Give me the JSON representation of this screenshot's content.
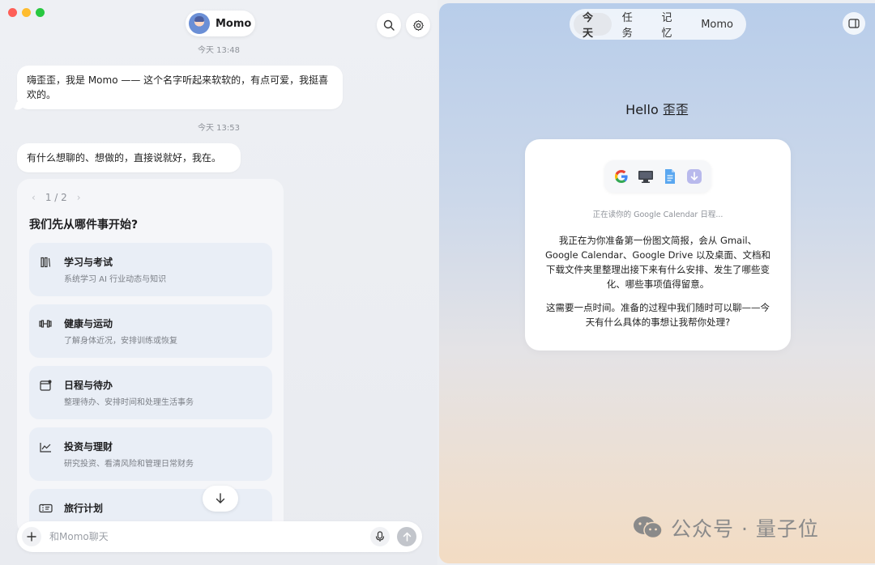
{
  "window": {
    "traffic_lights": [
      "close",
      "minimize",
      "zoom"
    ]
  },
  "header": {
    "agent_name": "Momo",
    "search_icon": "search-icon",
    "settings_icon": "gear-icon"
  },
  "chat": {
    "messages": [
      {
        "timestamp": "今天 13:48",
        "text": "嗨歪歪，我是 Momo —— 这个名字听起来软软的，有点可爱，我挺喜欢的。"
      },
      {
        "timestamp": "今天 13:53",
        "text": "有什么想聊的、想做的，直接说就好，我在。"
      }
    ],
    "card": {
      "pager": "1 / 2",
      "title": "我们先从哪件事开始?",
      "topics": [
        {
          "icon": "book-icon",
          "name": "学习与考试",
          "desc": "系统学习 AI 行业动态与知识"
        },
        {
          "icon": "dumbbell-icon",
          "name": "健康与运动",
          "desc": "了解身体近况，安排训练或恢复"
        },
        {
          "icon": "calendar-icon",
          "name": "日程与待办",
          "desc": "整理待办、安排时间和处理生活事务"
        },
        {
          "icon": "chart-icon",
          "name": "投资与理财",
          "desc": "研究投资、看清风险和管理日常财务"
        },
        {
          "icon": "ticket-icon",
          "name": "旅行计划",
          "desc": ""
        }
      ]
    }
  },
  "composer": {
    "placeholder": "和Momo聊天"
  },
  "right": {
    "tabs": [
      "今天",
      "任务",
      "记忆",
      "Momo"
    ],
    "active_tab": "今天",
    "greeting": "Hello 歪歪",
    "status": "正在读你的 Google Calendar 日程...",
    "paragraph1": "我正在为你准备第一份图文简报，会从 Gmail、Google Calendar、Google Drive 以及桌面、文档和下载文件夹里整理出接下来有什么安排、发生了哪些变化、哪些事项值得留意。",
    "paragraph2": "这需要一点时间。准备的过程中我们随时可以聊——今天有什么具体的事想让我帮你处理?",
    "source_icons": [
      "google-icon",
      "monitor-icon",
      "document-icon",
      "download-icon"
    ]
  },
  "watermark": {
    "text": "公众号 · 量子位"
  },
  "colors": {
    "topic_bg": "#e9eef6",
    "right_gradient_top": "#b8cdea",
    "right_gradient_bottom": "#f3dcc3",
    "traffic_red": "#fe5f57",
    "traffic_yellow": "#febc2e",
    "traffic_green": "#28c840"
  }
}
